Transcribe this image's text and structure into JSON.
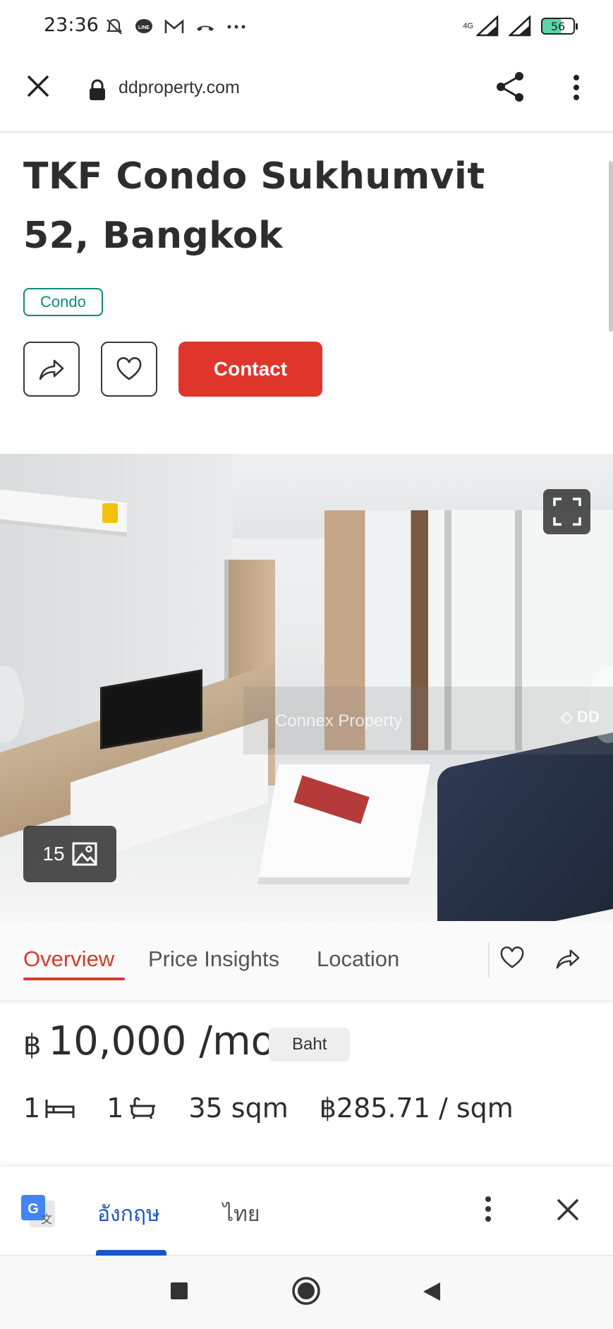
{
  "status_bar": {
    "time": "23:36",
    "network": "4G",
    "battery": "56",
    "icons": [
      "bell-off-icon",
      "line-icon",
      "gmail-icon",
      "missed-call-icon",
      "more-dots-icon",
      "signal-icon",
      "signal-icon-2",
      "battery-icon"
    ]
  },
  "browser": {
    "url": "ddproperty.com",
    "icons": [
      "close-icon",
      "lock-icon",
      "share-icon",
      "more-vert-icon"
    ]
  },
  "listing": {
    "title": "TKF Condo Sukhumvit 52, Bangkok",
    "tag": "Condo",
    "contact_label": "Contact"
  },
  "photo": {
    "count": "15",
    "watermark": "Connex Property",
    "watermark_logo": "DD"
  },
  "tabs": {
    "items": [
      "Overview",
      "Price Insights",
      "Location"
    ],
    "active": "Overview"
  },
  "price": {
    "currency": "฿",
    "amount": "10,000 /mo",
    "unit_badge": "Baht"
  },
  "specs": {
    "bedrooms": "1",
    "bathrooms": "1",
    "area": "35 sqm",
    "price_per_sqm": "฿285.71 / sqm"
  },
  "translate_bar": {
    "lang_source": "อังกฤษ",
    "lang_target": "ไทย",
    "active_lang": "อังกฤษ"
  },
  "colors": {
    "accent_red": "#e0352b",
    "tag_teal": "#0f8a7e",
    "translate_blue": "#1a56c4"
  }
}
